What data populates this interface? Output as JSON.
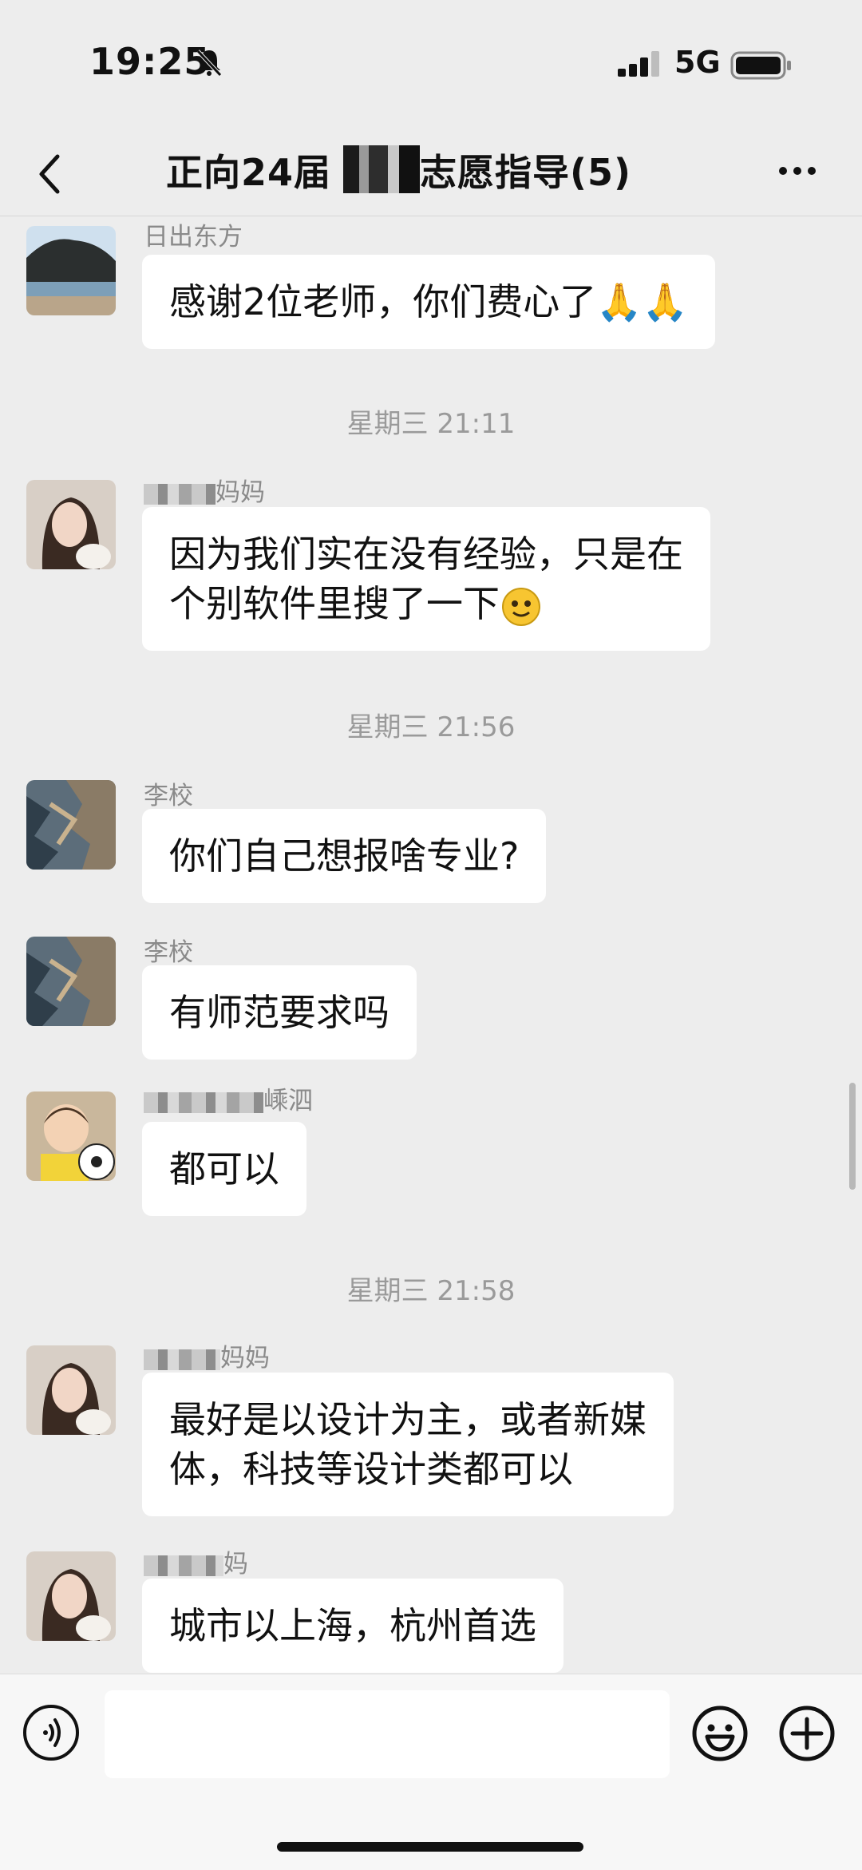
{
  "status_bar": {
    "time": "19:25",
    "network": "5G"
  },
  "header": {
    "title": "正向24届     家庭志愿指导(5)"
  },
  "messages": [
    {
      "sender": "日出东方",
      "text": "感谢2位老师，你们费心了",
      "emoji": "🙏🙏"
    },
    {
      "timestamp": "星期三 21:11"
    },
    {
      "sender_suffix": "妈妈",
      "text_line1": "因为我们实在没有经验，只是在",
      "text_line2": "个别软件里搜了一下"
    },
    {
      "timestamp": "星期三 21:56"
    },
    {
      "sender": "李校",
      "text": "你们自己想报啥专业?"
    },
    {
      "sender": "李校",
      "text": "有师范要求吗"
    },
    {
      "sender_suffix": "嵊泗",
      "text": "都可以"
    },
    {
      "timestamp": "星期三 21:58"
    },
    {
      "sender_suffix": "妈妈",
      "text_line1": "最好是以设计为主，或者新媒",
      "text_line2": "体，科技等设计类都可以"
    },
    {
      "sender_suffix": "妈",
      "text": "城市以上海，杭州首选"
    }
  ],
  "input": {
    "placeholder": ""
  },
  "icons": [
    "bell-muted-icon",
    "signal-icon",
    "battery-icon",
    "back-icon",
    "more-icon",
    "voice-icon",
    "emoji-icon",
    "plus-icon"
  ]
}
